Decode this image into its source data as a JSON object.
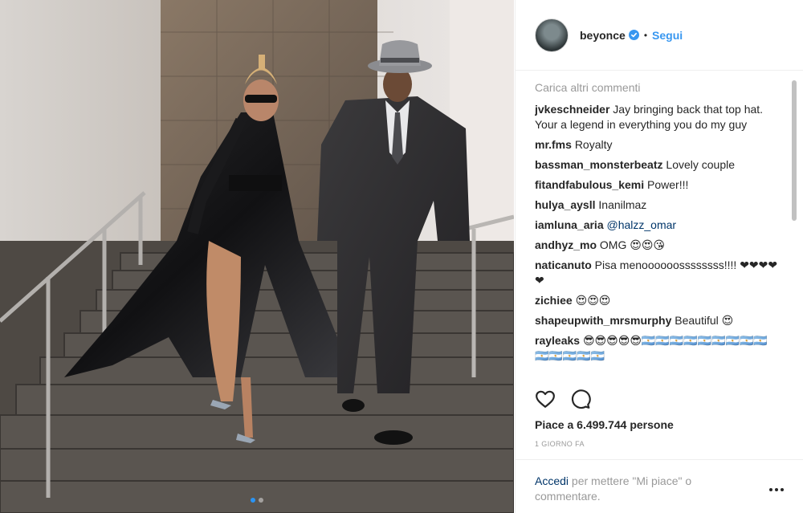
{
  "post": {
    "image_alt": "",
    "carousel": {
      "dot_count": 2,
      "active_index": 0
    }
  },
  "header": {
    "username": "beyonce",
    "separator": "•",
    "follow_label": "Segui"
  },
  "comments": {
    "load_more": "Carica altri commenti",
    "items": [
      {
        "author": "jvkeschneider",
        "text": "Jay bringing back that top hat. Your a legend in everything you do my guy"
      },
      {
        "author": "mr.fms",
        "text": "Royalty"
      },
      {
        "author": "bassman_monsterbeatz",
        "text": "Lovely couple"
      },
      {
        "author": "fitandfabulous_kemi",
        "text": "Power!!!"
      },
      {
        "author": "hulya_aysll",
        "text": "Inanilmaz"
      },
      {
        "author": "iamluna_aria",
        "mention": "@halzz_omar",
        "text": ""
      },
      {
        "author": "andhyz_mo",
        "text": "OMG 😍😍😘"
      },
      {
        "author": "naticanuto",
        "text": "Pisa menoooooossssssss!!!! ❤❤❤❤❤"
      },
      {
        "author": "zichiee",
        "text": "😍😍😍"
      },
      {
        "author": "shapeupwith_mrsmurphy",
        "text": "Beautiful 😍"
      },
      {
        "author": "rayleaks",
        "text": "😎😎😎😎😎🇦🇷🇦🇷🇦🇷🇦🇷🇦🇷🇦🇷🇦🇷🇦🇷🇦🇷🇦🇷🇦🇷🇦🇷🇦🇷🇦🇷"
      }
    ]
  },
  "actions": {
    "like_icon": "heart-icon",
    "comment_icon": "comment-icon"
  },
  "likes": {
    "text": "Piace a 6.499.744 persone"
  },
  "timestamp": "1 GIORNO FA",
  "login": {
    "link": "Accedi",
    "rest": " per mettere \"Mi piace\" o commentare."
  },
  "colors": {
    "accent": "#3897f0",
    "muted": "#999999",
    "link_dark": "#003569"
  }
}
